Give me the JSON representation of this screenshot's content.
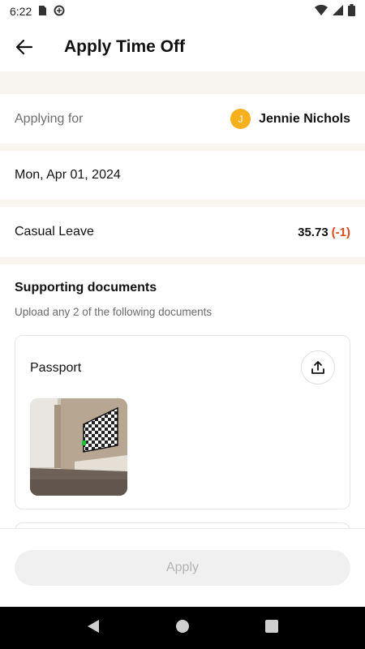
{
  "status_bar": {
    "time": "6:22"
  },
  "app_bar": {
    "title": "Apply Time Off"
  },
  "applying_for": {
    "label": "Applying for",
    "avatar_initial": "J",
    "name": "Jennie Nichols",
    "avatar_color": "#f6b01c"
  },
  "date": {
    "value": "Mon, Apr 01, 2024"
  },
  "leave": {
    "type": "Casual Leave",
    "balance": "35.73",
    "delta": "(-1)",
    "delta_color": "#d64a1c"
  },
  "documents": {
    "title": "Supporting documents",
    "subtitle": "Upload any 2 of the following documents",
    "items": [
      {
        "label": "Passport"
      }
    ]
  },
  "footer": {
    "apply_label": "Apply"
  },
  "colors": {
    "background_band": "#f8f5f0",
    "accent": "#f6b01c"
  }
}
